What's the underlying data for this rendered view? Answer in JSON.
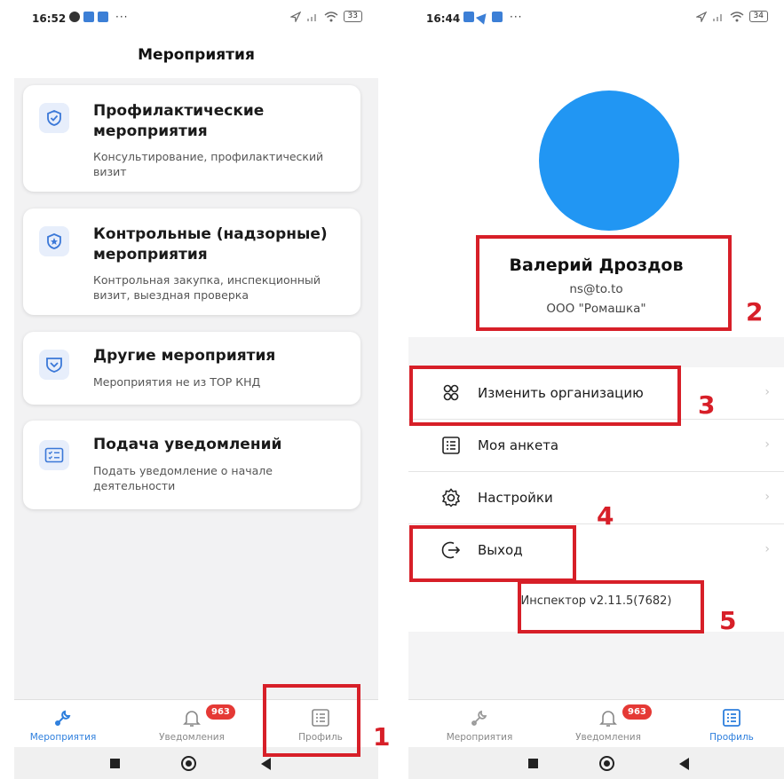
{
  "left_screen": {
    "status_time": "16:52",
    "status_dots": "···",
    "battery": "33",
    "page_title": "Мероприятия",
    "cards": [
      {
        "title": "Профилактические мероприятия",
        "subtitle": "Консультирование, профилактический визит",
        "icon": "shield-check-icon"
      },
      {
        "title": "Контрольные (надзорные) мероприятия",
        "subtitle": "Контрольная закупка, инспекционный визит, выездная проверка",
        "icon": "shield-star-icon"
      },
      {
        "title": "Другие мероприятия",
        "subtitle": "Мероприятия не из ТОР КНД",
        "icon": "shield-chevron-icon"
      },
      {
        "title": "Подача уведомлений",
        "subtitle": "Подать уведомление о начале деятельности",
        "icon": "checklist-icon"
      }
    ],
    "tabs": [
      {
        "label": "Мероприятия",
        "active": true
      },
      {
        "label": "Уведомления",
        "active": false,
        "badge": "963"
      },
      {
        "label": "Профиль",
        "active": false
      }
    ]
  },
  "right_screen": {
    "status_time": "16:44",
    "status_dots": "···",
    "battery": "34",
    "profile": {
      "name": "Валерий Дроздов",
      "email": "ns@to.to",
      "organization": "ООО \"Ромашка\""
    },
    "menu": [
      {
        "label": "Изменить организацию",
        "icon": "organization-icon"
      },
      {
        "label": "Моя анкета",
        "icon": "form-list-icon"
      },
      {
        "label": "Настройки",
        "icon": "settings-gear-icon"
      },
      {
        "label": "Выход",
        "icon": "logout-icon"
      }
    ],
    "version": "Инспектор v2.11.5(7682)",
    "tabs": [
      {
        "label": "Мероприятия",
        "active": false
      },
      {
        "label": "Уведомления",
        "active": false,
        "badge": "963"
      },
      {
        "label": "Профиль",
        "active": true
      }
    ]
  },
  "annotations": [
    "1",
    "2",
    "3",
    "4",
    "5"
  ],
  "colors": {
    "accent": "#2e7fdd",
    "avatar": "#2196f3",
    "badge": "#e53935",
    "annotation_red": "#d71f28"
  }
}
